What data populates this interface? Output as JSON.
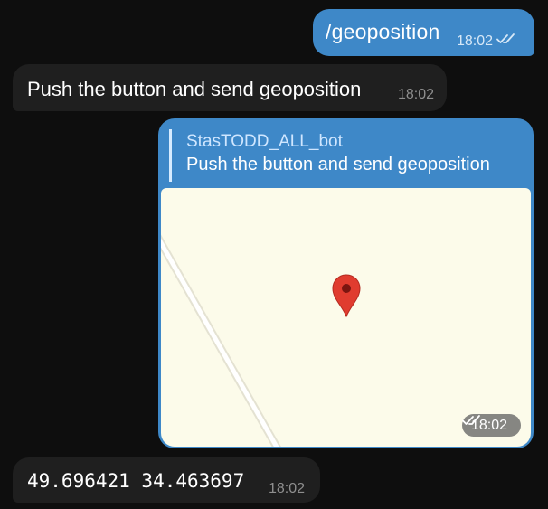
{
  "messages": [
    {
      "direction": "outgoing",
      "text": "/geoposition",
      "time": "18:02",
      "status_icon": "double-check-icon"
    },
    {
      "direction": "incoming",
      "text": "Push the button and send geoposition",
      "time": "18:02"
    },
    {
      "direction": "outgoing",
      "type": "location",
      "reply": {
        "author": "StasTODD_ALL_bot",
        "text": "Push the button and send geoposition"
      },
      "map": {
        "pin_icon": "map-pin-icon",
        "road": "diagonal road"
      },
      "time": "18:02",
      "status_icon": "double-check-icon"
    },
    {
      "direction": "incoming",
      "text": "49.696421 34.463697",
      "time": "18:02"
    }
  ],
  "colors": {
    "background": "#0e0e0e",
    "outgoing_bubble": "#3e88c8",
    "incoming_bubble": "#1f1f1f",
    "map_background": "#fcfbea",
    "pin": "#e03c2f"
  }
}
